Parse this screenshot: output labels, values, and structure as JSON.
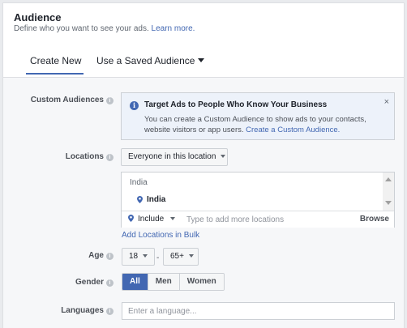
{
  "header": {
    "title": "Audience",
    "subtitle": "Define who you want to see your ads.",
    "learn_more": "Learn more."
  },
  "tabs": {
    "create_new": "Create New",
    "saved": "Use a Saved Audience"
  },
  "custom_audiences": {
    "label": "Custom Audiences",
    "notice_title": "Target Ads to People Who Know Your Business",
    "notice_text": "You can create a Custom Audience to show ads to your contacts, website visitors or app users.",
    "notice_link": "Create a Custom Audience.",
    "close": "×"
  },
  "locations": {
    "label": "Locations",
    "scope": "Everyone in this location",
    "country": "India",
    "item": "India",
    "include": "Include",
    "placeholder": "Type to add more locations",
    "browse": "Browse",
    "bulk_link": "Add Locations in Bulk"
  },
  "age": {
    "label": "Age",
    "min": "18",
    "separator": "-",
    "max": "65+"
  },
  "gender": {
    "label": "Gender",
    "options": [
      "All",
      "Men",
      "Women"
    ],
    "selected": "All"
  },
  "languages": {
    "label": "Languages",
    "placeholder": "Enter a language..."
  },
  "colors": {
    "accent": "#4267b2",
    "notice_bg": "#edf2fa"
  }
}
